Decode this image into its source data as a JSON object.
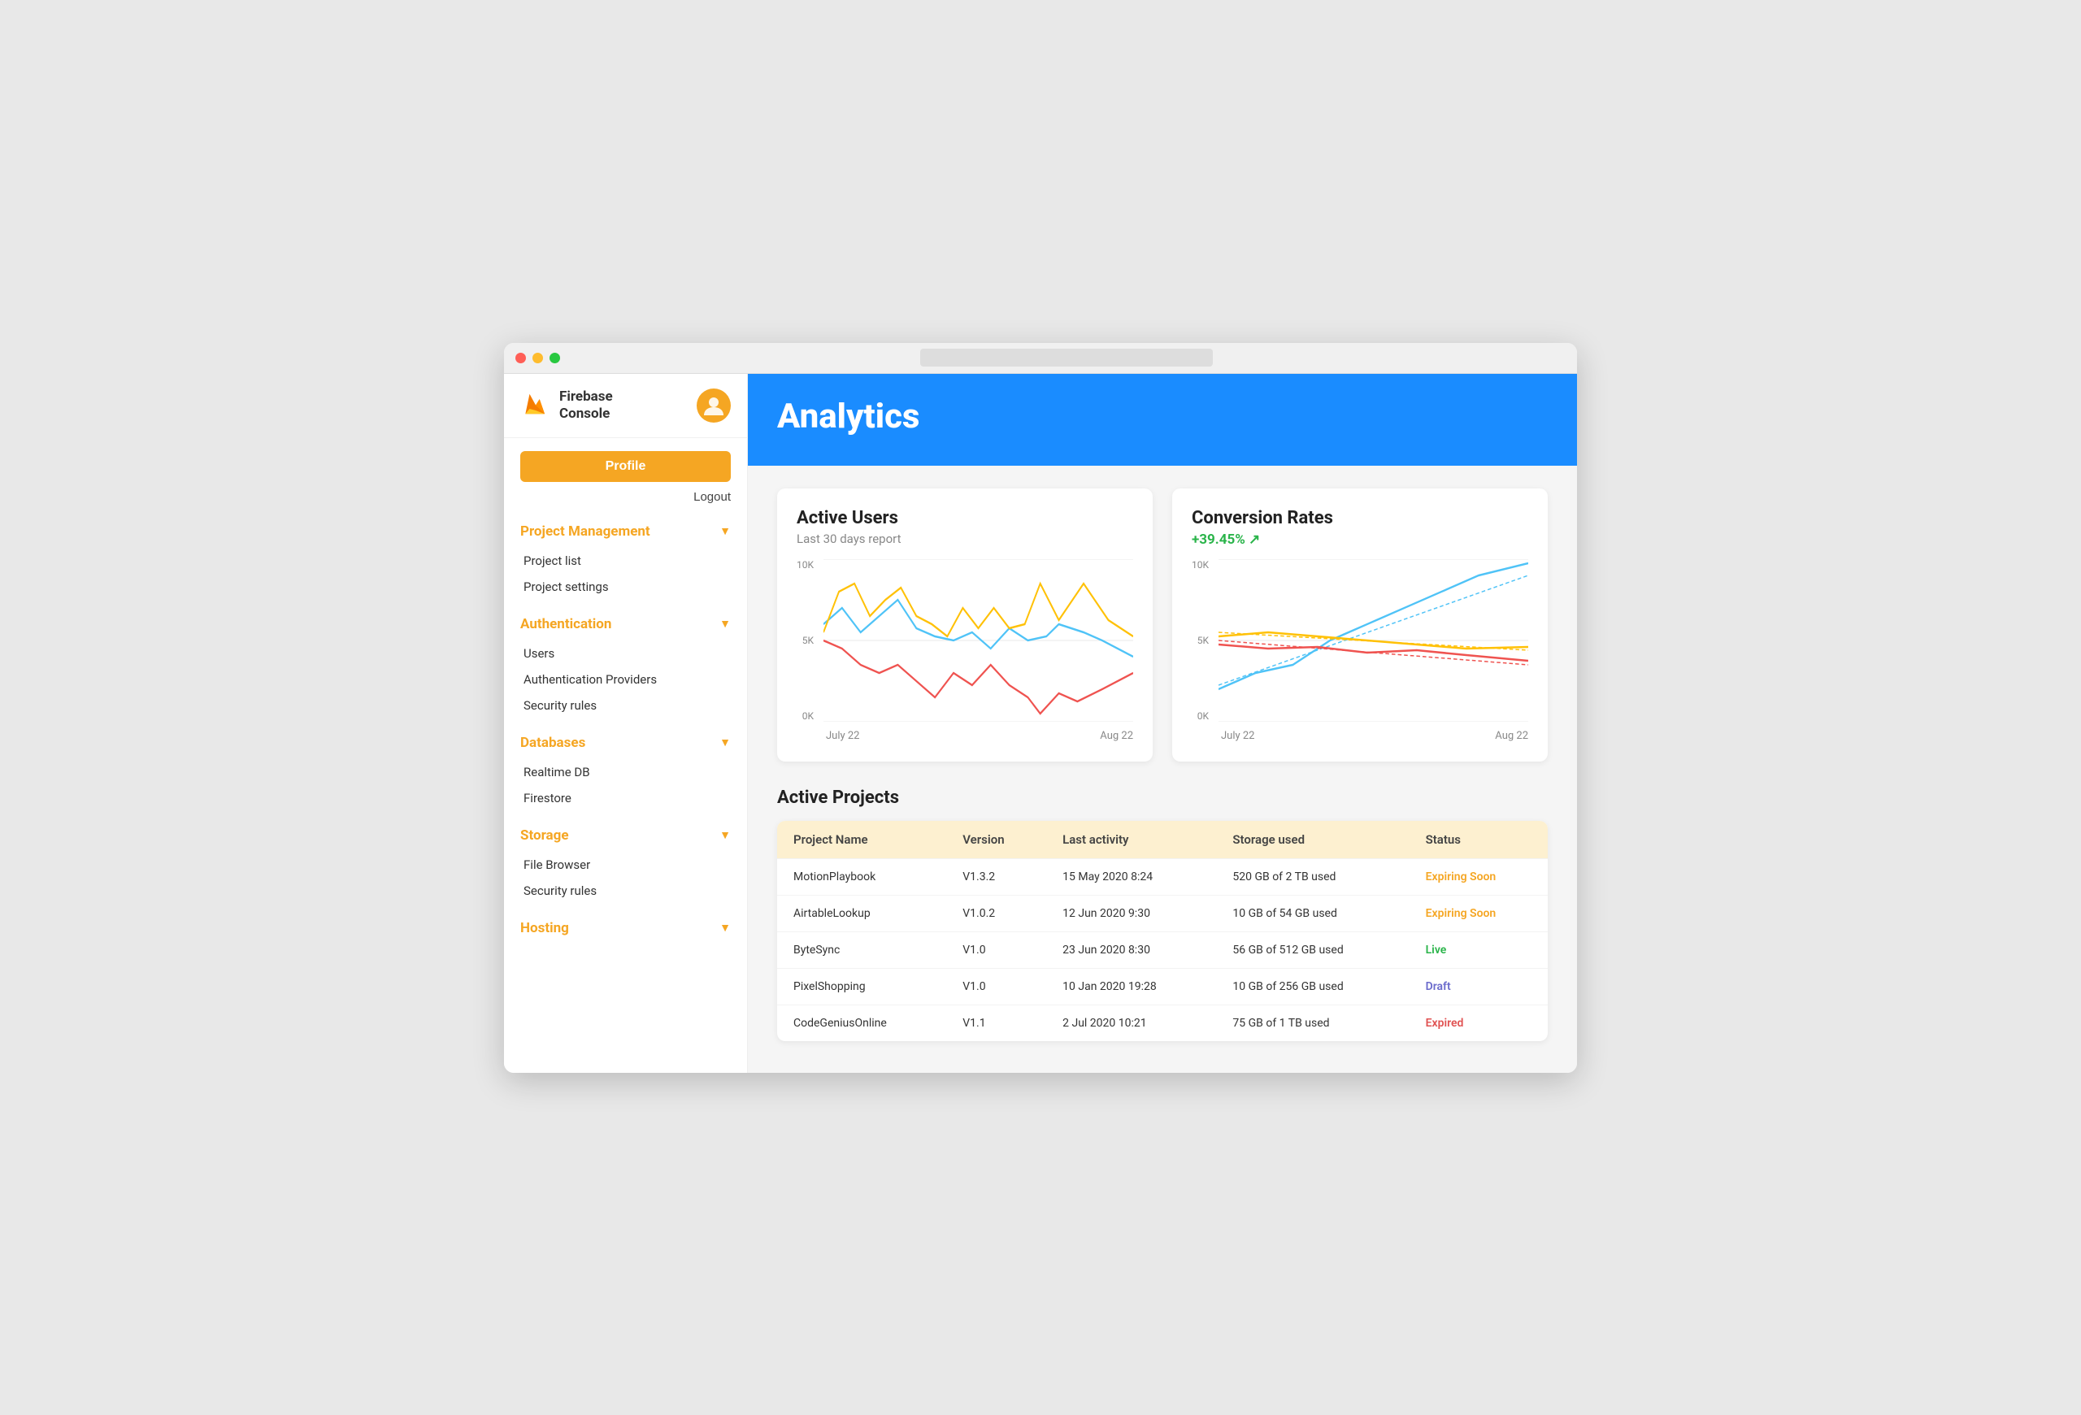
{
  "titlebar": {
    "search_placeholder": ""
  },
  "sidebar": {
    "brand_name": "Firebase\nConsole",
    "profile_label": "Profile",
    "logout_label": "Logout",
    "sections": [
      {
        "id": "project-management",
        "title": "Project Management",
        "items": [
          "Project list",
          "Project settings"
        ]
      },
      {
        "id": "authentication",
        "title": "Authentication",
        "items": [
          "Users",
          "Authentication Providers",
          "Security rules"
        ]
      },
      {
        "id": "databases",
        "title": "Databases",
        "items": [
          "Realtime DB",
          "Firestore"
        ]
      },
      {
        "id": "storage",
        "title": "Storage",
        "items": [
          "File Browser",
          "Security rules"
        ]
      },
      {
        "id": "hosting",
        "title": "Hosting",
        "items": []
      }
    ]
  },
  "main": {
    "title": "Analytics",
    "charts": {
      "active_users": {
        "title": "Active Users",
        "subtitle": "Last 30 days report",
        "x_start": "July 22",
        "x_end": "Aug 22",
        "y_top": "10K",
        "y_mid": "5K",
        "y_bot": "0K"
      },
      "conversion_rates": {
        "title": "Conversion Rates",
        "change": "+39.45% ↗",
        "x_start": "July 22",
        "x_end": "Aug 22",
        "y_top": "10K",
        "y_mid": "5K",
        "y_bot": "0K"
      }
    },
    "active_projects": {
      "section_title": "Active Projects",
      "columns": [
        "Project Name",
        "Version",
        "Last activity",
        "Storage used",
        "Status"
      ],
      "rows": [
        {
          "name": "MotionPlaybook",
          "version": "V1.3.2",
          "last_activity": "15 May 2020 8:24",
          "storage": "520 GB of 2 TB used",
          "status": "Expiring Soon",
          "status_class": "status-expiring"
        },
        {
          "name": "AirtableLookup",
          "version": "V1.0.2",
          "last_activity": "12 Jun 2020 9:30",
          "storage": "10 GB of 54 GB used",
          "status": "Expiring Soon",
          "status_class": "status-expiring"
        },
        {
          "name": "ByteSync",
          "version": "V1.0",
          "last_activity": "23 Jun 2020 8:30",
          "storage": "56 GB of 512 GB used",
          "status": "Live",
          "status_class": "status-live"
        },
        {
          "name": "PixelShopping",
          "version": "V1.0",
          "last_activity": "10 Jan 2020 19:28",
          "storage": "10 GB of 256 GB used",
          "status": "Draft",
          "status_class": "status-draft"
        },
        {
          "name": "CodeGeniusOnline",
          "version": "V1.1",
          "last_activity": "2 Jul 2020 10:21",
          "storage": "75 GB of 1 TB used",
          "status": "Expired",
          "status_class": "status-expired"
        }
      ]
    }
  }
}
